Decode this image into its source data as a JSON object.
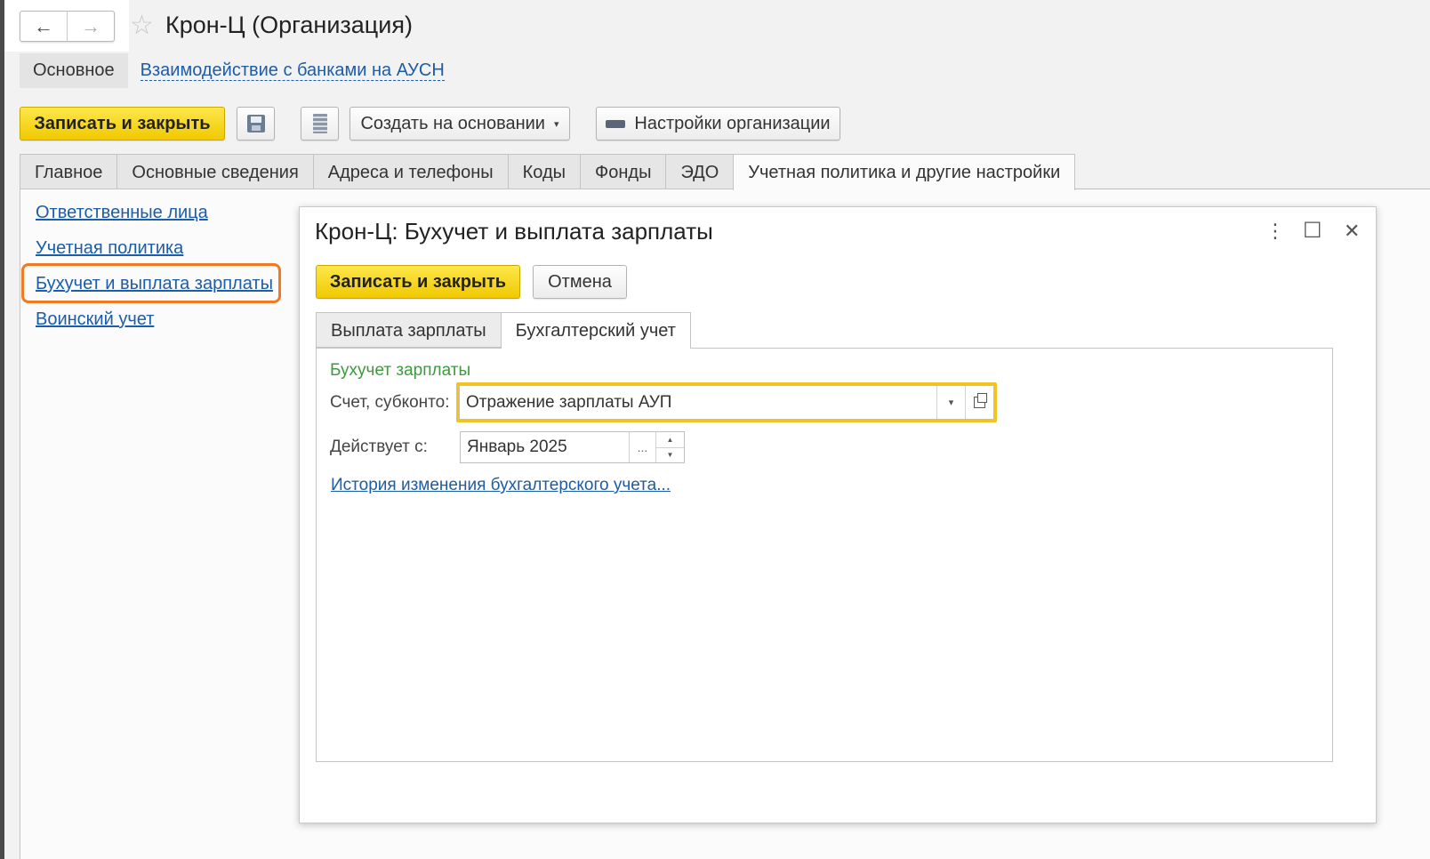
{
  "window": {
    "title": "Крон-Ц (Организация)",
    "nav_back_icon": "←",
    "nav_forward_icon": "→",
    "star_icon": "☆"
  },
  "sections": {
    "main": "Основное",
    "banks_link": "Взаимодействие с банками на АУСН"
  },
  "toolbar": {
    "save_close": "Записать и закрыть",
    "create_based_on": "Создать на основании",
    "org_settings": "Настройки организации"
  },
  "tabs": [
    "Главное",
    "Основные сведения",
    "Адреса и телефоны",
    "Коды",
    "Фонды",
    "ЭДО",
    "Учетная политика и другие настройки"
  ],
  "side_links": [
    "Ответственные лица",
    "Учетная политика",
    "Бухучет и выплата зарплаты",
    "Воинский учет"
  ],
  "modal": {
    "title": "Крон-Ц: Бухучет и выплата зарплаты",
    "more_icon": "⋮",
    "maximize_icon": "☐",
    "close_icon": "✕",
    "save_close": "Записать и закрыть",
    "cancel": "Отмена",
    "tabs": [
      "Выплата зарплаты",
      "Бухгалтерский учет"
    ],
    "group_title": "Бухучет зарплаты",
    "account_label": "Счет, субконто:",
    "account_value": "Отражение зарплаты АУП",
    "effective_label": "Действует с:",
    "effective_value": "Январь 2025",
    "dots": "...",
    "history_link": "История изменения бухгалтерского учета..."
  },
  "colors": {
    "accent_yellow": "#f5d31a",
    "link_blue": "#1c5ca8",
    "highlight_orange": "#f07922",
    "group_green": "#3c9a3c"
  }
}
